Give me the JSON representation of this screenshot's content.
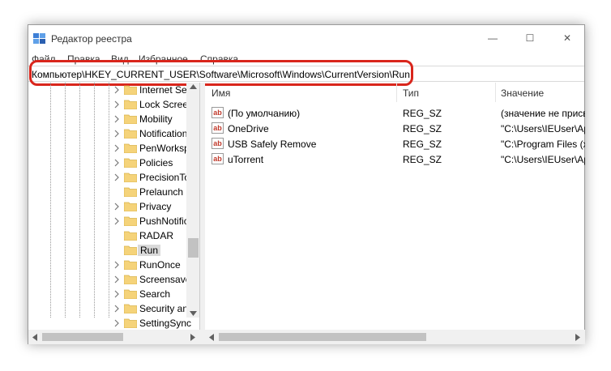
{
  "window": {
    "title": "Редактор реестра",
    "buttons": {
      "minimize": "—",
      "maximize": "☐",
      "close": "✕"
    }
  },
  "menu": [
    "Файл",
    "Правка",
    "Вид",
    "Избранное",
    "Справка"
  ],
  "address": {
    "path": "Компьютер\\HKEY_CURRENT_USER\\Software\\Microsoft\\Windows\\CurrentVersion\\Run"
  },
  "tree": {
    "items": [
      {
        "label": "Internet Set"
      },
      {
        "label": "Lock Screen"
      },
      {
        "label": "Mobility"
      },
      {
        "label": "Notification"
      },
      {
        "label": "PenWorksp"
      },
      {
        "label": "Policies"
      },
      {
        "label": "PrecisionTo"
      },
      {
        "label": "Prelaunch"
      },
      {
        "label": "Privacy"
      },
      {
        "label": "PushNotific"
      },
      {
        "label": "RADAR"
      },
      {
        "label": "Run"
      },
      {
        "label": "RunOnce"
      },
      {
        "label": "Screensave"
      },
      {
        "label": "Search"
      },
      {
        "label": "Security an"
      },
      {
        "label": "SettingSync"
      }
    ]
  },
  "list": {
    "columns": {
      "name": "Имя",
      "type": "Тип",
      "value": "Значение"
    },
    "rows": [
      {
        "name": "(По умолчанию)",
        "type": "REG_SZ",
        "value": "(значение не присв"
      },
      {
        "name": "OneDrive",
        "type": "REG_SZ",
        "value": "\"C:\\Users\\IEUser\\Ap"
      },
      {
        "name": "USB Safely Remove",
        "type": "REG_SZ",
        "value": "\"C:\\Program Files (x"
      },
      {
        "name": "uTorrent",
        "type": "REG_SZ",
        "value": "\"C:\\Users\\IEUser\\Ap"
      }
    ],
    "icon_text": "ab"
  },
  "colors": {
    "highlight": "#d9261c",
    "folder": "#f5d37a",
    "selection": "#d9d9d9"
  }
}
